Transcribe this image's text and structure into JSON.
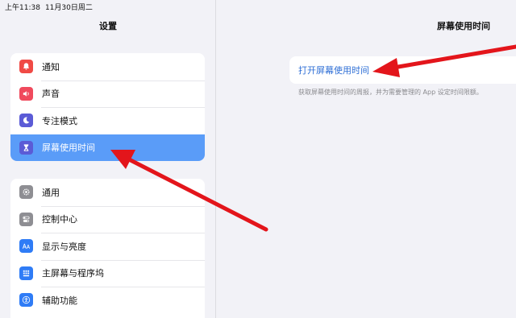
{
  "status_bar": {
    "time": "上午11:38",
    "date": "11月30日周二"
  },
  "sidebar": {
    "title": "设置",
    "groups": [
      [
        {
          "label": "通知",
          "icon": "bell-icon",
          "color": "#f04a45"
        },
        {
          "label": "声音",
          "icon": "speaker-icon",
          "color": "#f04a5d"
        },
        {
          "label": "专注模式",
          "icon": "moon-icon",
          "color": "#5b5bd6"
        },
        {
          "label": "屏幕使用时间",
          "icon": "hourglass-icon",
          "color": "#5b5bd6",
          "active": true
        }
      ],
      [
        {
          "label": "通用",
          "icon": "gear-icon",
          "color": "#8e8e93"
        },
        {
          "label": "控制中心",
          "icon": "switches-icon",
          "color": "#8e8e93"
        },
        {
          "label": "显示与亮度",
          "icon": "text-size-icon",
          "color": "#2f7cf6"
        },
        {
          "label": "主屏幕与程序坞",
          "icon": "grid-icon",
          "color": "#2f7cf6"
        },
        {
          "label": "辅助功能",
          "icon": "accessibility-icon",
          "color": "#2f7cf6"
        }
      ]
    ]
  },
  "main": {
    "title": "屏幕使用时间",
    "link": "打开屏幕使用时间",
    "description": "获取屏幕使用时间的周报，并为需要管理的 App 设定时间限额。"
  },
  "colors": {
    "accent": "#5a9cf8",
    "link": "#2f6fd6",
    "arrow": "#e3151b"
  }
}
